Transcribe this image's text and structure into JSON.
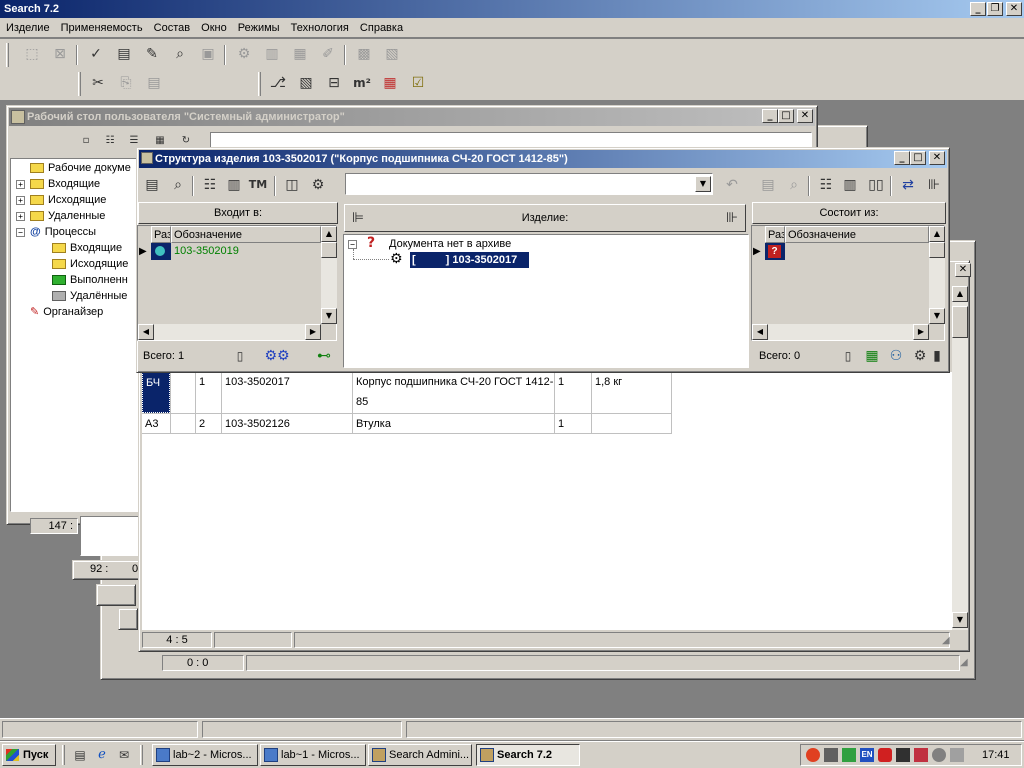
{
  "app": {
    "title": "Search 7.2",
    "menu": [
      "Изделие",
      "Применяемость",
      "Состав",
      "Окно",
      "Режимы",
      "Технология",
      "Справка"
    ]
  },
  "toolbar2": {
    "m2_label": "m²"
  },
  "desktop_window": {
    "title": "Рабочий стол пользователя \"Системный администратор\"",
    "tree": [
      {
        "label": "Рабочие докуме",
        "level": 0
      },
      {
        "label": "Входящие",
        "level": 0
      },
      {
        "label": "Исходящие",
        "level": 0
      },
      {
        "label": "Удаленные",
        "level": 0
      },
      {
        "label": "Процессы",
        "level": 0
      },
      {
        "label": "Входящие",
        "level": 1
      },
      {
        "label": "Исходящие",
        "level": 1
      },
      {
        "label": "Выполненн",
        "level": 1
      },
      {
        "label": "Удалённые",
        "level": 1
      },
      {
        "label": "Органайзер",
        "level": 0
      }
    ],
    "status_147": "147 :",
    "status_92": "92 :",
    "status_0": "0"
  },
  "structure_window": {
    "title": "Структура изделия 103-3502017 (\"Корпус подшипника СЧ-20 ГОСТ 1412-85\")",
    "left_panel": {
      "header": "Входит в:",
      "columns": [
        "Раз",
        "Обозначение"
      ],
      "rows": [
        {
          "designation": "103-3502019"
        }
      ],
      "total": "Всего: 1"
    },
    "center_panel": {
      "header": "Изделие:",
      "tree_root": "Документа нет в архиве",
      "tree_child_prefix": "[",
      "tree_child_bracket": "]",
      "tree_child": "103-3502017"
    },
    "right_panel": {
      "header": "Состоит из:",
      "columns": [
        "Раз",
        "Обозначение"
      ],
      "total": "Всего: 0"
    }
  },
  "spec_table": {
    "rows": [
      {
        "format": "БЧ",
        "pos": "1",
        "designation": "103-3502017",
        "name": "Корпус подшипника СЧ-20 ГОСТ 1412-",
        "name2": "85",
        "qty": "1",
        "note": "1,8 кг"
      },
      {
        "format": "А3",
        "pos": "2",
        "designation": "103-3502126",
        "name": "Втулка",
        "name2": "",
        "qty": "1",
        "note": ""
      }
    ],
    "status_pos": "4 : 5",
    "status_pos2": "0 :     0"
  },
  "taskbar": {
    "start": "Пуск",
    "tasks": [
      {
        "label": "lab~2 - Micros..."
      },
      {
        "label": "lab~1 - Micros..."
      },
      {
        "label": "Search Admini..."
      },
      {
        "label": "Search 7.2"
      }
    ],
    "clock": "17:41"
  },
  "colors": {
    "title_active": "#0a246a",
    "selection": "#0a246a",
    "desktop": "#808080",
    "green_text": "#008000"
  }
}
